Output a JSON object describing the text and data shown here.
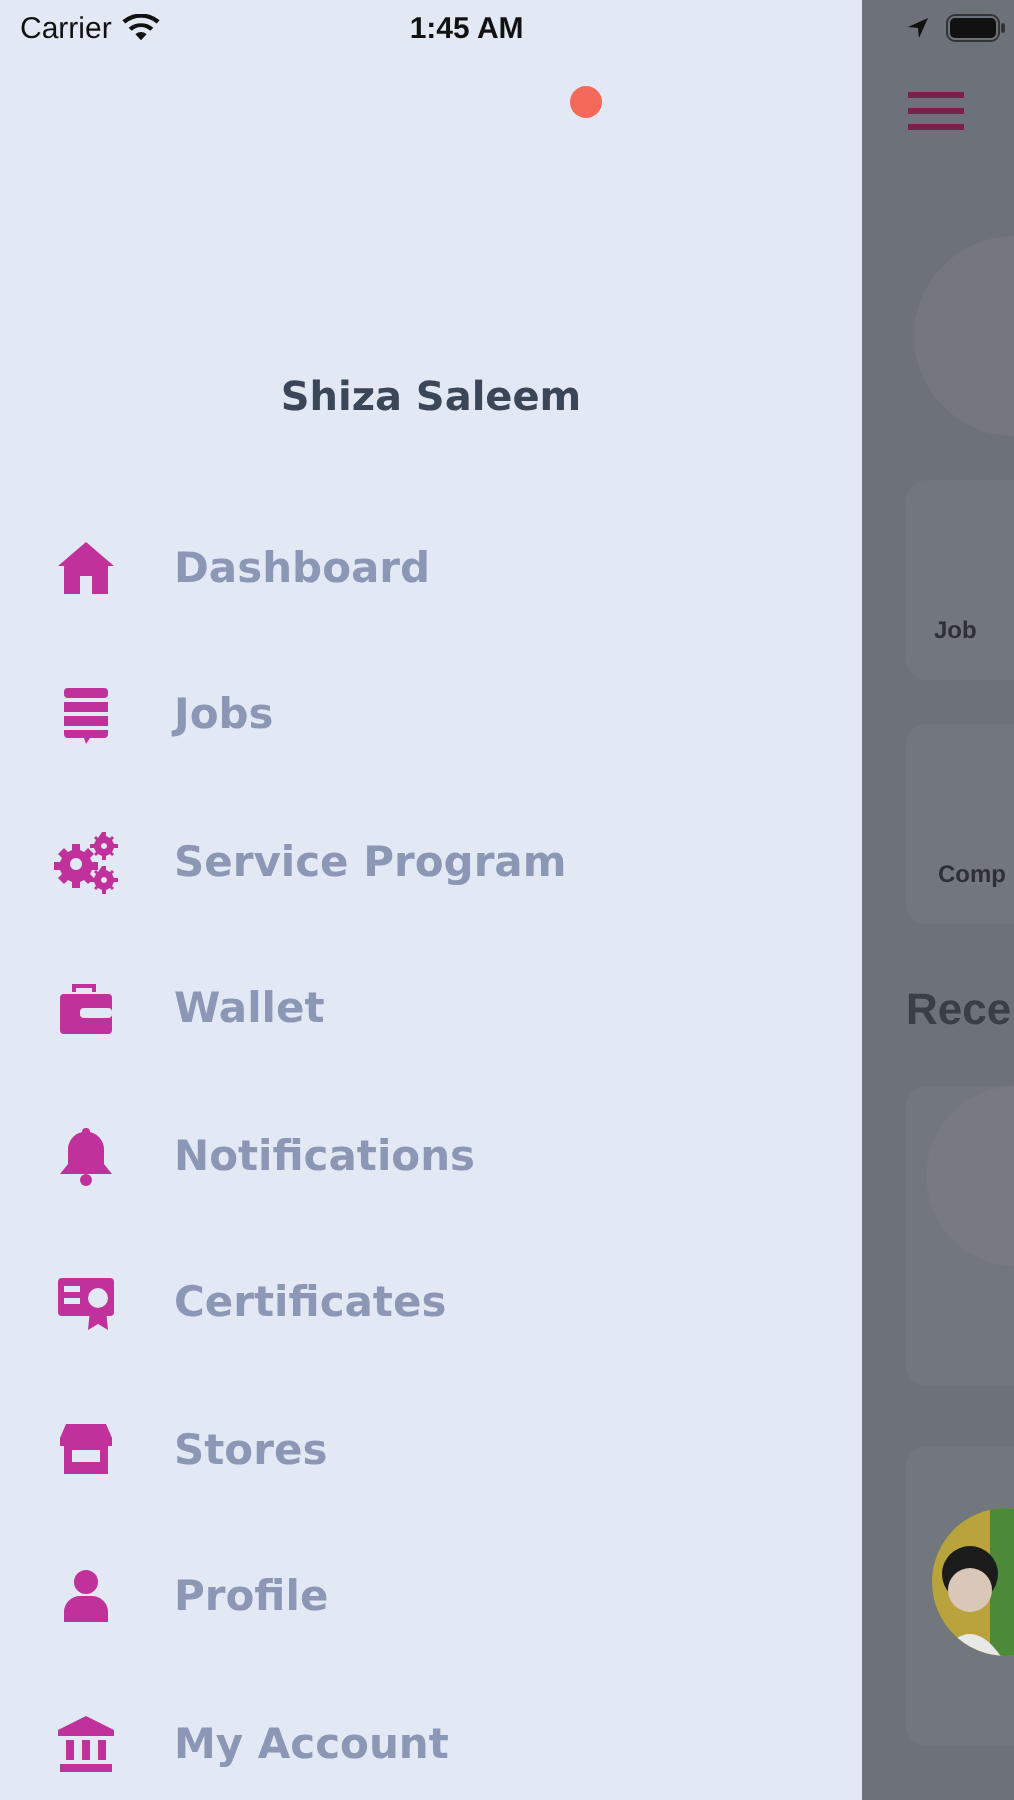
{
  "status_bar": {
    "carrier": "Carrier",
    "time": "1:45 AM"
  },
  "drawer": {
    "user_name": "Shiza Saleem",
    "items": [
      {
        "label": "Dashboard",
        "kind": "home"
      },
      {
        "label": "Jobs",
        "kind": "jobs"
      },
      {
        "label": "Service Program",
        "kind": "gears"
      },
      {
        "label": "Wallet",
        "kind": "wallet"
      },
      {
        "label": "Notifications",
        "kind": "bell"
      },
      {
        "label": "Certificates",
        "kind": "certificate"
      },
      {
        "label": "Stores",
        "kind": "store"
      },
      {
        "label": "Profile",
        "kind": "person"
      },
      {
        "label": "My Account",
        "kind": "bank"
      }
    ]
  },
  "background_page": {
    "cards": [
      {
        "label": "Job"
      },
      {
        "label": "Comp"
      }
    ],
    "section_title": "Rece"
  }
}
